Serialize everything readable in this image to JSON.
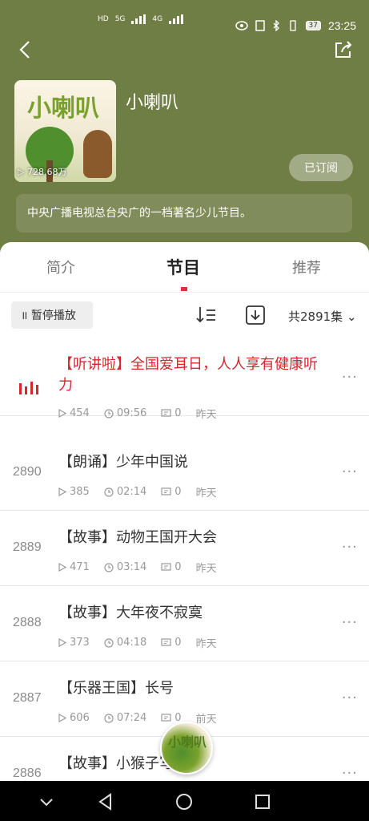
{
  "status_bar": {
    "left": [
      "HD",
      "5G",
      "4G"
    ],
    "time": "23:25",
    "battery": "37"
  },
  "podcast": {
    "title": "小喇叭",
    "cover_title": "小喇叭",
    "play_count": "728.68万",
    "subscribe_label": "已订阅",
    "description": "中央广播电视总台央广的一档著名少儿节目。"
  },
  "tabs": [
    {
      "label": "简介"
    },
    {
      "label": "节目"
    },
    {
      "label": "推荐"
    }
  ],
  "toolbar": {
    "pause_label": "暂停播放",
    "count_label": "共2891集"
  },
  "episodes": [
    {
      "num": "",
      "title": "【听讲啦】全国爱耳日，人人享有健康听力",
      "plays": "454",
      "duration": "09:56",
      "comments": "0",
      "date": "昨天"
    },
    {
      "num": "2890",
      "title": "【朗诵】少年中国说",
      "plays": "385",
      "duration": "02:14",
      "comments": "0",
      "date": "昨天"
    },
    {
      "num": "2889",
      "title": "【故事】动物王国开大会",
      "plays": "471",
      "duration": "03:14",
      "comments": "0",
      "date": "昨天"
    },
    {
      "num": "2888",
      "title": "【故事】大年夜不寂寞",
      "plays": "373",
      "duration": "04:18",
      "comments": "0",
      "date": "昨天"
    },
    {
      "num": "2887",
      "title": "【乐器王国】长号",
      "plays": "606",
      "duration": "07:24",
      "comments": "0",
      "date": "前天"
    },
    {
      "num": "2886",
      "title": "【故事】小猴子写字",
      "plays": "",
      "duration": "",
      "comments": "",
      "date": ""
    }
  ],
  "colors": {
    "header_bg": "#6f7e44",
    "accent_red": "#d8262f"
  }
}
